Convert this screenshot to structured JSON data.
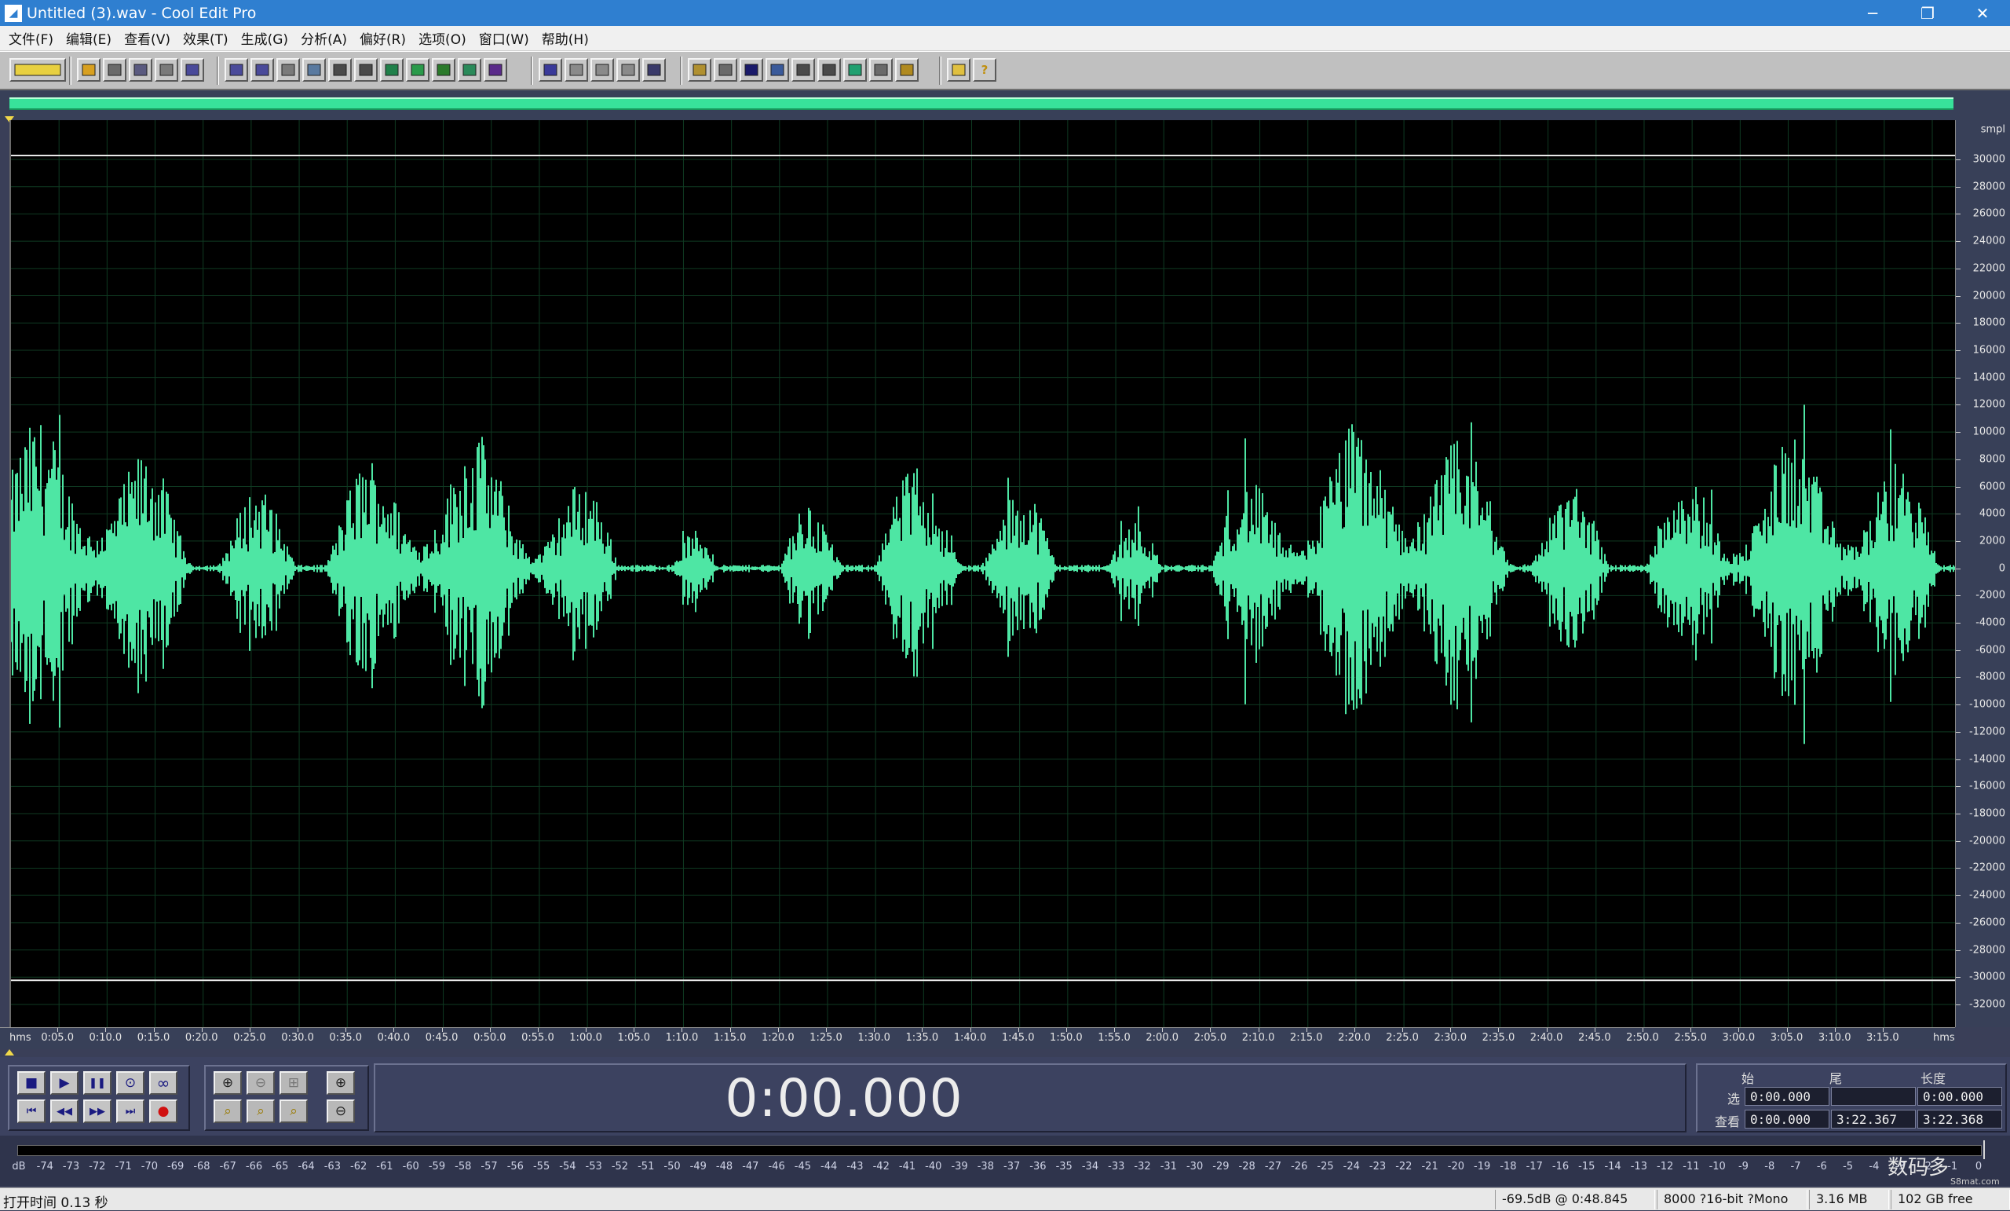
{
  "window": {
    "title": "Untitled (3).wav - Cool Edit Pro",
    "app_icon_glyph": "◢",
    "minimize": "─",
    "maximize": "❐",
    "close": "✕"
  },
  "menu": [
    "文件(F)",
    "编辑(E)",
    "查看(V)",
    "效果(T)",
    "生成(G)",
    "分析(A)",
    "偏好(R)",
    "选项(O)",
    "窗口(W)",
    "帮助(H)"
  ],
  "toolbar": {
    "icons": [
      "multitrack-icon",
      "new-file-icon",
      "open-file-icon",
      "save-icon",
      "save-as-icon",
      "close-file-icon",
      "undo-icon",
      "redo-icon",
      "repeat-icon",
      "copy-icon",
      "paste-icon",
      "cut-icon",
      "trim-icon",
      "mix-paste-icon",
      "insert-icon",
      "zoom-tool-icon",
      "spectral-icon",
      "edit-marker-icon",
      "grid-a-icon",
      "grid-b-icon",
      "grid-c-icon",
      "view-a-icon",
      "view-b-icon",
      "view-c-icon",
      "play-view-icon",
      "scan-icon",
      "time-015-icon",
      "view-d-icon",
      "view-e-icon",
      "view-f-icon",
      "settings-icon",
      "fx-icon",
      "help-icon"
    ],
    "help_glyph": "?"
  },
  "colors": {
    "waveform": "#4ee6a4",
    "background": "#000000",
    "grid": "#0f3a22",
    "panel": "#384058"
  },
  "y_axis": {
    "unit": "smpl",
    "ticks": [
      "30000",
      "28000",
      "26000",
      "24000",
      "22000",
      "20000",
      "18000",
      "16000",
      "14000",
      "12000",
      "10000",
      "8000",
      "6000",
      "4000",
      "2000",
      "0",
      "-2000",
      "-4000",
      "-6000",
      "-8000",
      "-10000",
      "-12000",
      "-14000",
      "-16000",
      "-18000",
      "-20000",
      "-22000",
      "-24000",
      "-26000",
      "-28000",
      "-30000",
      "-32000"
    ]
  },
  "time_axis": {
    "unit_left": "hms",
    "unit_right": "hms",
    "ticks": [
      "0:05.0",
      "0:10.0",
      "0:15.0",
      "0:20.0",
      "0:25.0",
      "0:30.0",
      "0:35.0",
      "0:40.0",
      "0:45.0",
      "0:50.0",
      "0:55.0",
      "1:00.0",
      "1:05.0",
      "1:10.0",
      "1:15.0",
      "1:20.0",
      "1:25.0",
      "1:30.0",
      "1:35.0",
      "1:40.0",
      "1:45.0",
      "1:50.0",
      "1:55.0",
      "2:00.0",
      "2:05.0",
      "2:10.0",
      "2:15.0",
      "2:20.0",
      "2:25.0",
      "2:30.0",
      "2:35.0",
      "2:40.0",
      "2:45.0",
      "2:50.0",
      "2:55.0",
      "3:00.0",
      "3:05.0",
      "3:10.0",
      "3:15.0"
    ]
  },
  "transport": {
    "time": "0:00.000",
    "buttons": {
      "stop": "■",
      "play": "▶",
      "pause": "❚❚",
      "play_to_end": "⊙",
      "loop": "∞",
      "go_start": "⏮",
      "rewind": "◀◀",
      "fast_forward": "▶▶",
      "go_end": "⏭",
      "record": "●"
    },
    "zoom": {
      "zoom_in_h": "⊕",
      "zoom_out_h": "⊖",
      "zoom_full": "⊞",
      "zoom_in_v": "⊕",
      "zoom_sel": "⌕",
      "zoom_left": "⌕",
      "zoom_right": "⌕",
      "zoom_out_v": "⊖"
    }
  },
  "selection": {
    "headers": {
      "begin": "始",
      "end": "尾",
      "length": "长度"
    },
    "rows": [
      {
        "label": "选",
        "begin": "0:00.000",
        "end": "",
        "length": "0:00.000"
      },
      {
        "label": "查看",
        "begin": "0:00.000",
        "end": "3:22.367",
        "length": "3:22.368"
      }
    ]
  },
  "meter": {
    "labels": [
      "dB",
      "-74",
      "-73",
      "-72",
      "-71",
      "-70",
      "-69",
      "-68",
      "-67",
      "-66",
      "-65",
      "-64",
      "-63",
      "-62",
      "-61",
      "-60",
      "-59",
      "-58",
      "-57",
      "-56",
      "-55",
      "-54",
      "-53",
      "-52",
      "-51",
      "-50",
      "-49",
      "-48",
      "-47",
      "-46",
      "-45",
      "-44",
      "-43",
      "-42",
      "-41",
      "-40",
      "-39",
      "-38",
      "-37",
      "-36",
      "-35",
      "-34",
      "-33",
      "-32",
      "-31",
      "-30",
      "-29",
      "-28",
      "-27",
      "-26",
      "-25",
      "-24",
      "-23",
      "-22",
      "-21",
      "-20",
      "-19",
      "-18",
      "-17",
      "-16",
      "-15",
      "-14",
      "-13",
      "-12",
      "-11",
      "-10",
      "-9",
      "-8",
      "-7",
      "-6",
      "-5",
      "-4",
      "-3",
      "-2",
      "-1",
      "0"
    ]
  },
  "status": {
    "open_time": "打开时间  0.13 秒",
    "cursor": "-69.5dB @   0:48.845",
    "format": "8000 ?16-bit ?Mono",
    "size": "3.16 MB",
    "free": "102 GB free"
  },
  "watermark": {
    "text": "数码多",
    "sub": "S8mat.com"
  }
}
